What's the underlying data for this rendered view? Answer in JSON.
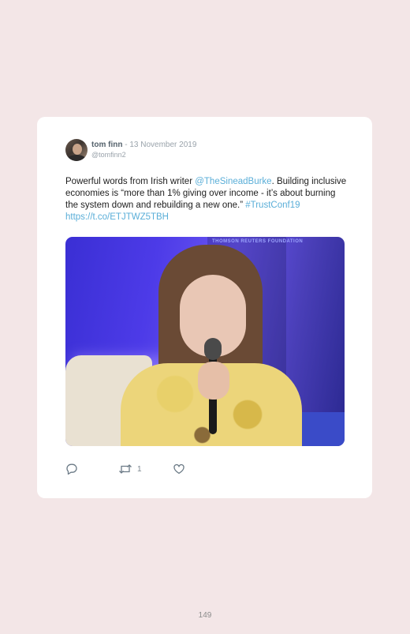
{
  "tweet": {
    "author_name": "tom finn",
    "date": " - 13 November 2019",
    "handle": "@tomfinn2",
    "text_1": "Powerful words from Irish writer ",
    "mention": "@TheSineadBurke",
    "text_2": ". Building inclusive economies is “more than 1% giving over income - it’s about burning the system down and rebuilding a new one.” ",
    "hashtag": "#TrustConf19",
    "link": "https://t.co/ETJTWZ5TBH",
    "media_banner": "THOMSON REUTERS FOUNDATION",
    "retweet_count": "1",
    "icons": [
      "reply-icon",
      "retweet-icon",
      "like-icon"
    ]
  },
  "page": {
    "number": "149"
  },
  "colors": {
    "background": "#f3e6e7",
    "card": "#ffffff",
    "link": "#5aaed8"
  }
}
